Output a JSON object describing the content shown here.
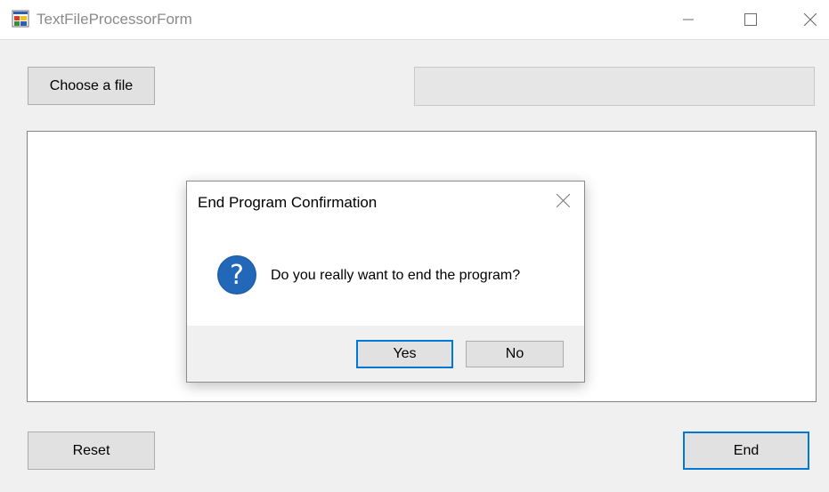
{
  "window": {
    "title": "TextFileProcessorForm",
    "icon": "windows-form-icon",
    "controls": [
      "minimize-icon",
      "maximize-icon",
      "close-icon"
    ]
  },
  "form": {
    "choose_file_label": "Choose a file",
    "file_path_value": "",
    "text_content": "",
    "reset_label": "Reset",
    "end_label": "End"
  },
  "dialog": {
    "title": "End Program Confirmation",
    "icon": "question-icon",
    "message": "Do you really want to end the program?",
    "yes_label": "Yes",
    "no_label": "No"
  },
  "colors": {
    "accent": "#0078d7",
    "question_icon": "#1d5fa8",
    "window_background": "#f0f0f0"
  }
}
